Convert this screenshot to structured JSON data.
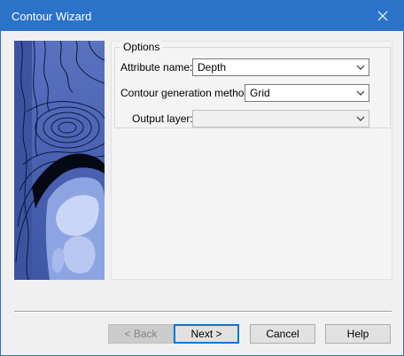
{
  "window": {
    "title": "Contour Wizard",
    "accent_color": "#2b73c8",
    "close_icon": "close-icon"
  },
  "options": {
    "group_title": "Options",
    "attribute_name": {
      "label": "Attribute name:",
      "value": "Depth"
    },
    "generation_method": {
      "label": "Contour generation method:",
      "value": "Grid"
    },
    "output_layer": {
      "label": "Output layer:",
      "value": ""
    }
  },
  "buttons": {
    "back": "< Back",
    "next": "Next >",
    "cancel": "Cancel",
    "help": "Help"
  }
}
